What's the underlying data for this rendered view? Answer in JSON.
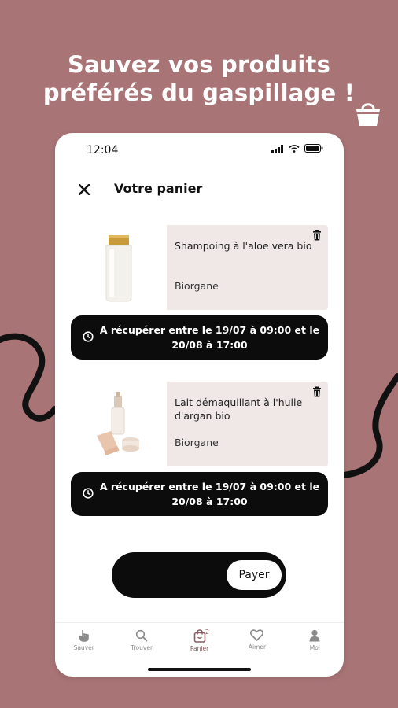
{
  "headline": {
    "line1": "Sauvez vos produits",
    "line2": "préférés du gaspillage !"
  },
  "status_bar": {
    "time": "12:04"
  },
  "header": {
    "close_icon": "close-icon",
    "title": "Votre panier"
  },
  "cart_items": [
    {
      "name": "Shampoing à l'aloe vera bio",
      "brand": "Biorgane",
      "pickup": "A récupérer entre le 19/07 à 09:00 et le 20/08 à 17:00"
    },
    {
      "name": "Lait démaquillant à l'huile d'argan bio",
      "brand": "Biorgane",
      "pickup": "A récupérer entre le 19/07 à 09:00 et le 20/08 à 17:00"
    }
  ],
  "pay": {
    "label": "Payer"
  },
  "bottom_nav": [
    {
      "label": "Sauver",
      "icon": "hand-icon"
    },
    {
      "label": "Trouver",
      "icon": "search-icon"
    },
    {
      "label": "Panier",
      "icon": "bag-icon",
      "badge": "2",
      "active": true
    },
    {
      "label": "Aimer",
      "icon": "heart-icon"
    },
    {
      "label": "Moi",
      "icon": "user-icon"
    }
  ],
  "colors": {
    "background": "#a87476",
    "accent": "#8a5c62",
    "card_bg": "#f0e8e6",
    "dark": "#0c0c0c"
  }
}
